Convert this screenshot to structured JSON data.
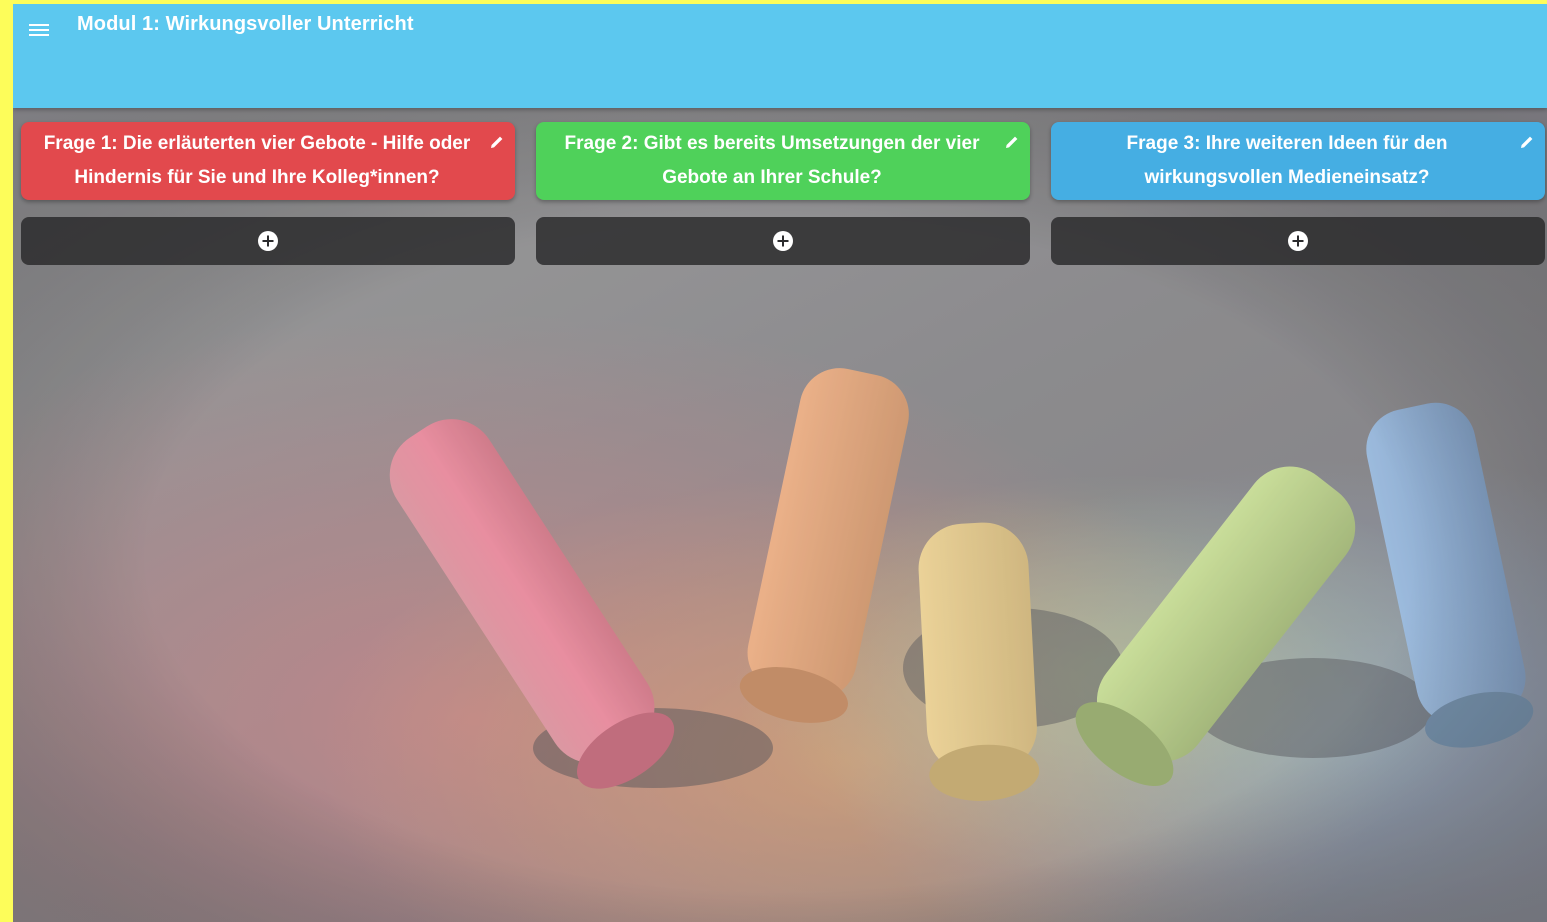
{
  "app": {
    "title": "Modul 1: Wirkungsvoller Unterricht"
  },
  "icons": {
    "menu": "menu-icon",
    "edit": "pencil-icon",
    "add": "plus-circle-icon"
  },
  "columns": [
    {
      "title": "Frage 1: Die erläuterten vier Gebote - Hilfe oder Hindernis für Sie und Ihre Kolleg*innen?",
      "color": "#e2494d"
    },
    {
      "title": "Frage 2: Gibt es bereits Umsetzungen der vier Gebote an Ihrer Schule?",
      "color": "#4fd15a"
    },
    {
      "title": "Frage 3: Ihre weiteren Ideen für den wirkungsvollen Medieneinsatz?",
      "color": "#45aee3"
    }
  ],
  "colors": {
    "appbar": "#5cc8ef",
    "frame": "#fdfd5a",
    "add_bar": "#2b2b2d"
  }
}
